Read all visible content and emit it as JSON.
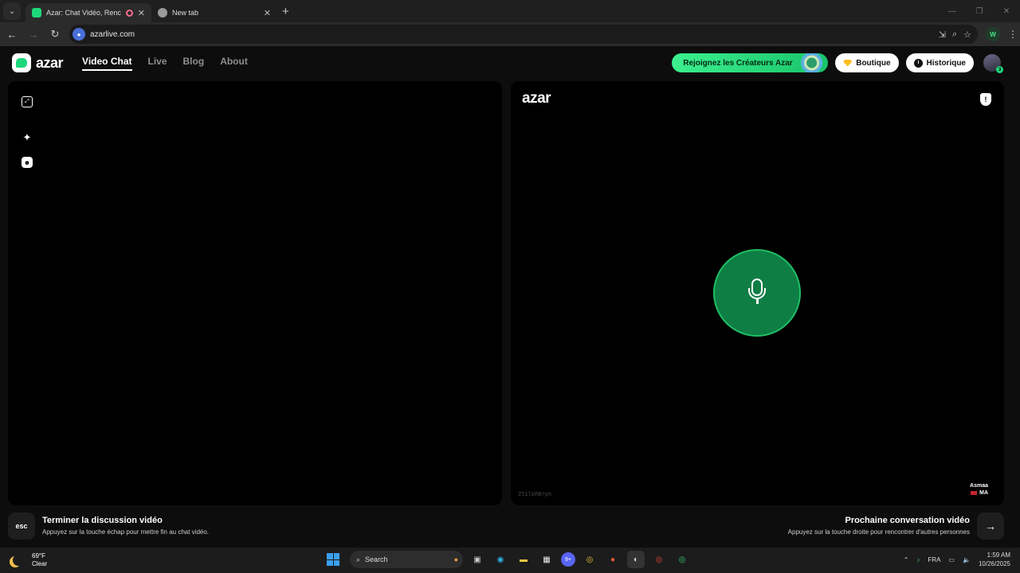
{
  "browser": {
    "tabs": [
      {
        "title": "Azar: Chat Vidéo, Rencontre",
        "active": true
      },
      {
        "title": "New tab",
        "active": false
      }
    ],
    "url": "azarlive.com",
    "profile_initial": "W"
  },
  "site": {
    "logo_text": "azar",
    "nav": [
      {
        "label": "Video Chat",
        "active": true
      },
      {
        "label": "Live",
        "active": false
      },
      {
        "label": "Blog",
        "active": false
      },
      {
        "label": "About",
        "active": false
      }
    ],
    "creators_label": "Rejoignez les Créateurs Azar",
    "shop_label": "Boutique",
    "history_label": "Historique",
    "avatar_badge": "3"
  },
  "remote_panel": {
    "brand": "azar",
    "session_id": "ZS1lbRBrph",
    "peer_name": "Asmaa",
    "peer_country": "MA"
  },
  "footer": {
    "esc_key": "esc",
    "end_title": "Terminer la discussion vidéo",
    "end_sub": "Appuyez sur la touche échap pour mettre fin au chat vidéo.",
    "next_title": "Prochaine conversation vidéo",
    "next_sub": "Appuyez sur la touche droite pour rencontrer d'autres personnes"
  },
  "taskbar": {
    "temperature": "69°F",
    "condition": "Clear",
    "search_label": "Search",
    "language": "FRA",
    "time": "1:59 AM",
    "date": "10/26/2025",
    "discord_badge": "9+"
  },
  "colors": {
    "accent_green": "#1ed77a",
    "mic_green": "#0e7e44"
  }
}
